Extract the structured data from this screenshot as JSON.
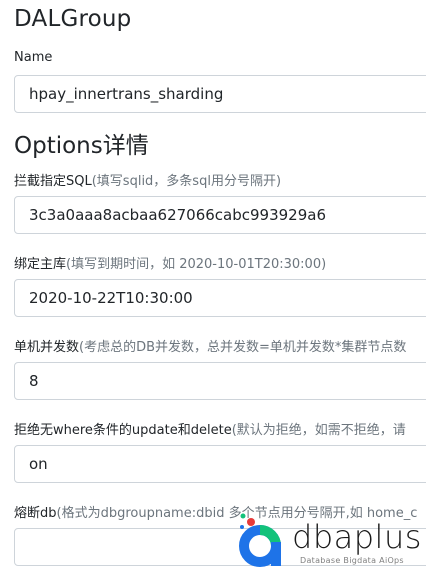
{
  "group": {
    "title": "DALGroup",
    "name_label": "Name",
    "name_value": "hpay_innertrans_sharding"
  },
  "options": {
    "title": "Options详情",
    "fields": [
      {
        "label": "拦截指定SQL",
        "hint": "(填写sqlid，多条sql用分号隔开)",
        "value": "3c3a0aaa8acbaa627066cabc993929a6"
      },
      {
        "label": "绑定主库",
        "hint": "(填写到期时间，如 2020-10-01T20:30:00)",
        "value": "2020-10-22T10:30:00"
      },
      {
        "label": "单机并发数",
        "hint": "(考虑总的DB并发数，总并发数=单机并发数*集群节点数",
        "value": "8"
      },
      {
        "label": "拒绝无where条件的update和delete",
        "hint": "(默认为拒绝，如需不拒绝，请",
        "value": "on"
      },
      {
        "label": "熔断db",
        "hint": "(格式为dbgroupname:dbid 多个节点用分号隔开,如 home_c",
        "value": ""
      }
    ]
  },
  "watermark": {
    "brand": "dbaplus",
    "tagline": "Database  Bigdata  AiOps",
    "colors": {
      "blue": "#1e73e8",
      "green": "#12c27a",
      "red": "#e63a3a"
    }
  }
}
